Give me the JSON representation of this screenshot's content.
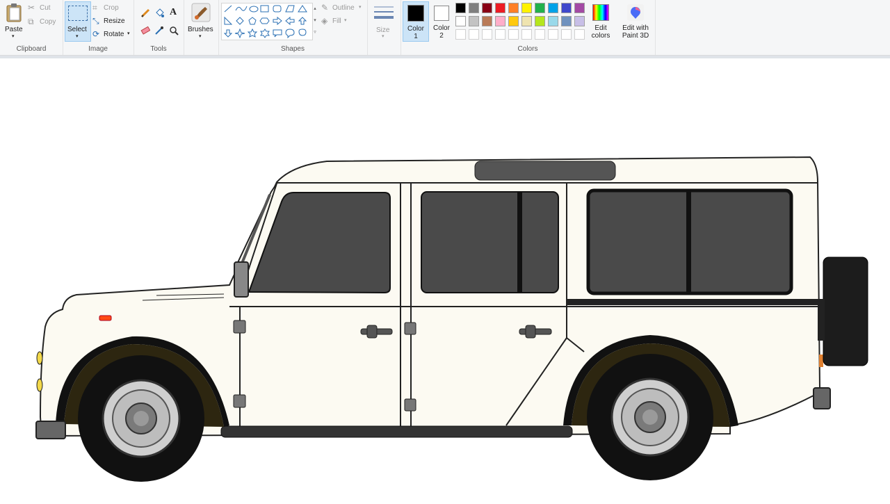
{
  "clipboard": {
    "paste": "Paste",
    "cut": "Cut",
    "copy": "Copy",
    "label": "Clipboard"
  },
  "image": {
    "select": "Select",
    "crop": "Crop",
    "resize": "Resize",
    "rotate": "Rotate",
    "label": "Image"
  },
  "tools": {
    "label": "Tools"
  },
  "brushes": {
    "label": "Brushes"
  },
  "shapes": {
    "label": "Shapes",
    "outline": "Outline",
    "fill": "Fill"
  },
  "size": {
    "label": "Size"
  },
  "colors": {
    "color1": "Color 1",
    "color2": "Color 2",
    "edit": "Edit colors",
    "paint3d": "Edit with Paint 3D",
    "label": "Colors",
    "row1": [
      "#000000",
      "#7f7f7f",
      "#880015",
      "#ed1c24",
      "#ff7f27",
      "#fff200",
      "#22b14c",
      "#00a2e8",
      "#3f48cc",
      "#a349a4"
    ],
    "row2": [
      "#ffffff",
      "#c3c3c3",
      "#b97a57",
      "#ffaec9",
      "#ffc90e",
      "#efe4b0",
      "#b5e61d",
      "#99d9ea",
      "#7092be",
      "#c8bfe7"
    ]
  }
}
